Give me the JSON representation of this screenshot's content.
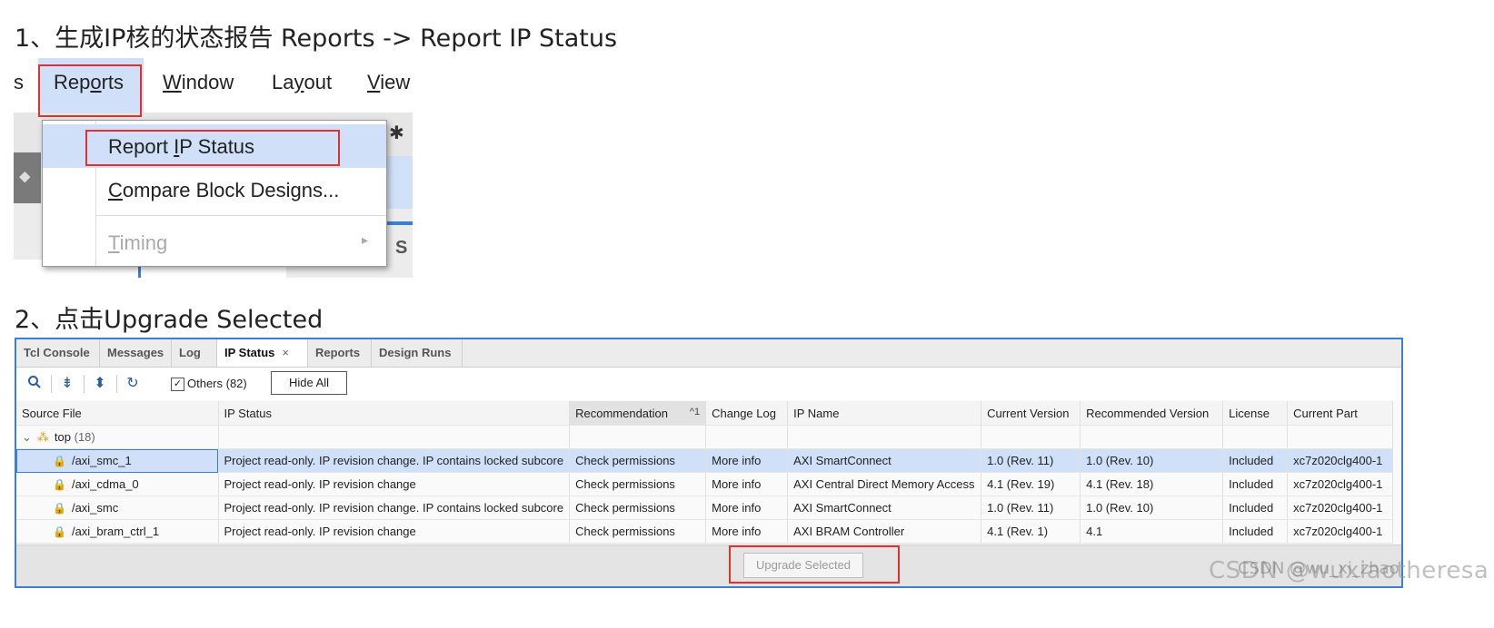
{
  "step1_title": "1、生成IP核的状态报告 Reports -> Report IP Status",
  "step2_title": "2、点击Upgrade Selected",
  "menubar": {
    "cut_item": "s",
    "items": [
      {
        "pre": "Rep",
        "mnem": "o",
        "post": "rts"
      },
      {
        "pre": "",
        "mnem": "W",
        "post": "indow"
      },
      {
        "pre": "La",
        "mnem": "y",
        "post": "out"
      },
      {
        "pre": "",
        "mnem": "V",
        "post": "iew"
      }
    ]
  },
  "dropdown": {
    "items": [
      {
        "pre": "Report ",
        "mnem": "I",
        "post": "P Status",
        "enabled": true,
        "highlighted": true
      },
      {
        "pre": "",
        "mnem": "C",
        "post": "ompare Block Designs...",
        "enabled": true
      },
      {
        "pre": "",
        "mnem": "T",
        "post": "iming",
        "enabled": false,
        "submenu": true
      }
    ]
  },
  "panel": {
    "tabs": [
      {
        "label": "Tcl Console"
      },
      {
        "label": "Messages"
      },
      {
        "label": "Log"
      },
      {
        "label": "IP Status",
        "active": true,
        "close": "×"
      },
      {
        "label": "Reports"
      },
      {
        "label": "Design Runs"
      }
    ],
    "toolbar": {
      "others_checked": true,
      "others_label": "Others (82)",
      "hide_all": "Hide All"
    },
    "columns": [
      "Source File",
      "IP Status",
      "Recommendation",
      "Change Log",
      "IP Name",
      "Current Version",
      "Recommended Version",
      "License",
      "Current Part"
    ],
    "sort_indicator": "^1",
    "group": {
      "name": "top",
      "count": "(18)"
    },
    "rows": [
      {
        "source": "/axi_smc_1",
        "status": "Project read-only. IP revision change. IP contains locked subcore",
        "recommendation": "Check permissions",
        "changelog": "More info",
        "ip_name": "AXI SmartConnect",
        "current": "1.0 (Rev. 11)",
        "recommended": "1.0 (Rev. 10)",
        "license": "Included",
        "part": "xc7z020clg400-1",
        "selected": true
      },
      {
        "source": "/axi_cdma_0",
        "status": "Project read-only. IP revision change",
        "recommendation": "Check permissions",
        "changelog": "More info",
        "ip_name": "AXI Central Direct Memory Access",
        "current": "4.1 (Rev. 19)",
        "recommended": "4.1 (Rev. 18)",
        "license": "Included",
        "part": "xc7z020clg400-1"
      },
      {
        "source": "/axi_smc",
        "status": "Project read-only. IP revision change. IP contains locked subcore",
        "recommendation": "Check permissions",
        "changelog": "More info",
        "ip_name": "AXI SmartConnect",
        "current": "1.0 (Rev. 11)",
        "recommended": "1.0 (Rev. 10)",
        "license": "Included",
        "part": "xc7z020clg400-1"
      },
      {
        "source": "/axi_bram_ctrl_1",
        "status": "Project read-only. IP revision change",
        "recommendation": "Check permissions",
        "changelog": "More info",
        "ip_name": "AXI BRAM Controller",
        "current": "4.1 (Rev. 1)",
        "recommended": "4.1",
        "license": "Included",
        "part": "xc7z020clg400-1"
      }
    ],
    "upgrade_button": "Upgrade Selected"
  },
  "watermark": "CSDN @wuxiaotheresa",
  "watermark_overlay": "CSDN @wu_xi_zhao"
}
